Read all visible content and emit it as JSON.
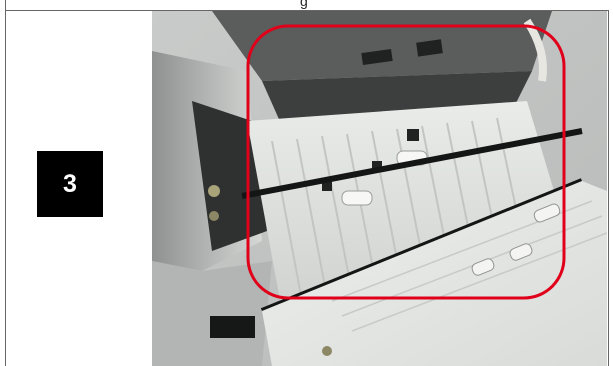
{
  "header": {
    "caption_fragment": "g"
  },
  "step": {
    "number": "3"
  },
  "photo": {
    "subject": "printer-paper-path-photo",
    "highlight_color": "#e0001a"
  }
}
